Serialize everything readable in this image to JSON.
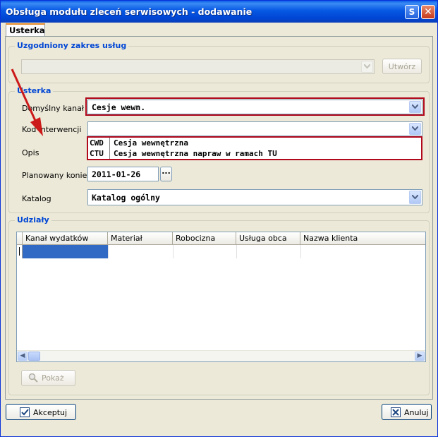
{
  "window": {
    "title": "Obsługa modułu zleceń serwisowych - dodawanie",
    "help_button": "S",
    "close_button": "✕"
  },
  "tabs": [
    {
      "label": "Usterka"
    }
  ],
  "uzgodniony": {
    "group_title": "Uzgodniony zakres usług",
    "combo_value": "",
    "create_button": "Utwórz"
  },
  "usterka": {
    "group_title": "Usterka",
    "domyslny_kanal": {
      "label": "Domyślny kanał",
      "value": "Cesje wewn."
    },
    "kod_interwencji": {
      "label": "Kod interwencji",
      "value": ""
    },
    "opis": {
      "label": "Opis"
    },
    "codes": [
      {
        "code": "CWD",
        "name": "Cesja wewnętrzna"
      },
      {
        "code": "CTU",
        "name": "Cesja wewnętrzna napraw w ramach TU"
      }
    ],
    "planowany_koniec": {
      "label": "Planowany koniec",
      "value": "2011-01-26",
      "picker": "..."
    },
    "katalog": {
      "label": "Katalog",
      "value": "Katalog ogólny"
    }
  },
  "udzialy": {
    "group_title": "Udziały",
    "columns": [
      "Kanał wydatków",
      "Materiał",
      "Robocizna",
      "Usługa obca",
      "Nazwa klienta"
    ],
    "show_button": "Pokaż"
  },
  "footer": {
    "accept_button": "Akceptuj",
    "cancel_button": "Anuluj"
  },
  "colors": {
    "title_blue": "#0058e6",
    "group_title": "#0046d5",
    "highlight_red": "#b1081b",
    "selection_blue": "#316ac5"
  }
}
